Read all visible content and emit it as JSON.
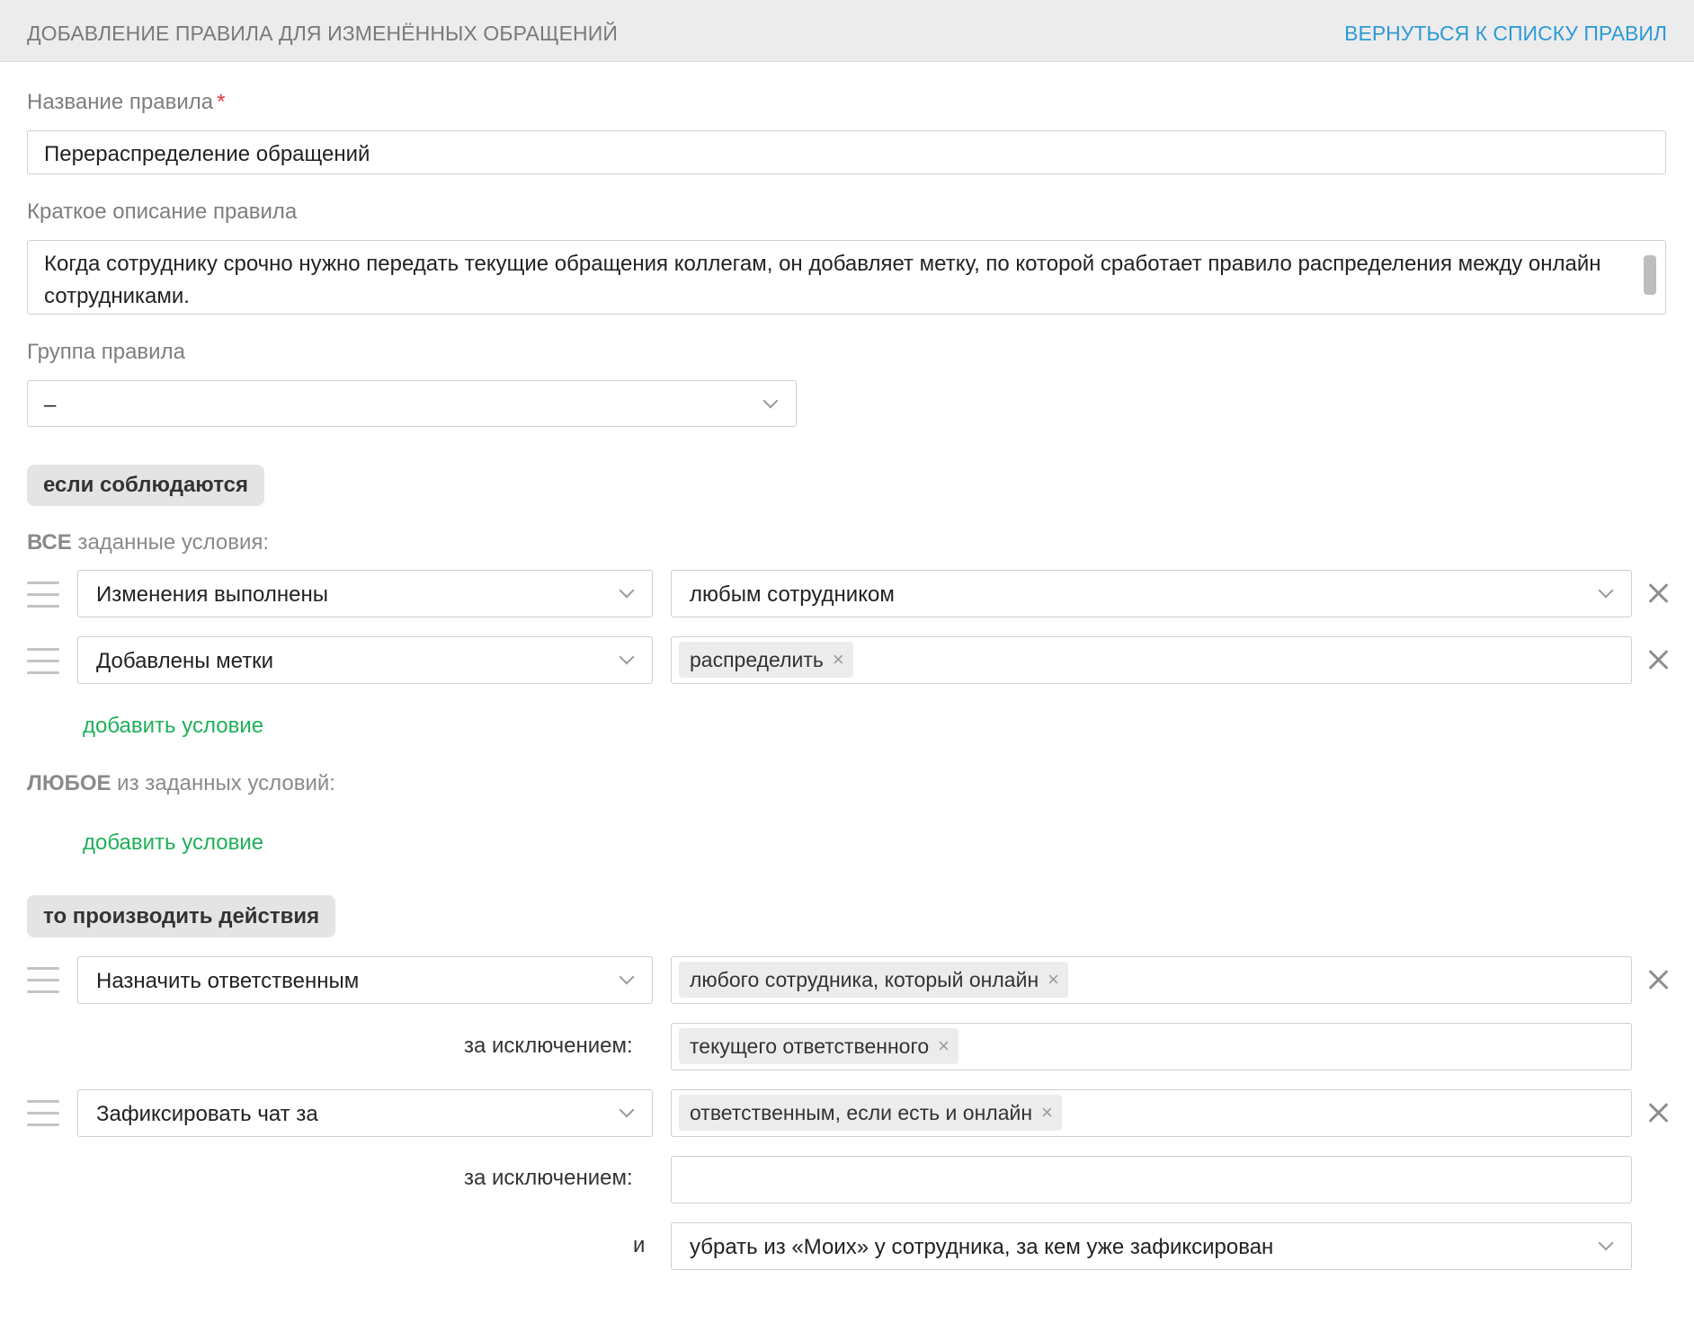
{
  "header": {
    "title": "ДОБАВЛЕНИЕ ПРАВИЛА ДЛЯ ИЗМЕНЁННЫХ ОБРАЩЕНИЙ",
    "back_link": "ВЕРНУТЬСЯ К СПИСКУ ПРАВИЛ"
  },
  "form": {
    "name_label": "Название правила",
    "required_mark": "*",
    "name_value": "Перераспределение обращений",
    "description_label": "Краткое описание правила",
    "description_value": "Когда сотруднику срочно нужно передать текущие обращения коллегам, он добавляет метку, по которой сработает правило распределения между онлайн сотрудниками.",
    "group_label": "Группа правила",
    "group_value": "–"
  },
  "conditions": {
    "pill": "если соблюдаются",
    "all_bold": "ВСЕ",
    "all_rest": " заданные условия:",
    "rows": [
      {
        "field": "Изменения выполнены",
        "value": "любым сотрудником"
      },
      {
        "field": "Добавлены метки",
        "tag": "распределить"
      }
    ],
    "add_label": "добавить условие",
    "any_bold": "ЛЮБОЕ",
    "any_rest": " из заданных условий:",
    "add_label_any": "добавить условие"
  },
  "actions": {
    "pill": "то производить действия",
    "rows": [
      {
        "field": "Назначить ответственным",
        "tag": "любого сотрудника, который онлайн",
        "except_label": "за исключением:",
        "except_tag": "текущего ответственного"
      },
      {
        "field": "Зафиксировать чат за",
        "tag": "ответственным, если есть и онлайн",
        "except_label": "за исключением:",
        "and_label": "и",
        "and_value": "убрать из «Моих» у сотрудника, за кем уже зафиксирован"
      }
    ]
  },
  "icons": {
    "remove": "close-icon",
    "drag": "drag-handle-icon",
    "dropdown": "chevron-down-icon",
    "tag_remove": "×"
  },
  "colors": {
    "header_bg": "#ececec",
    "link": "#2e9ad6",
    "add_link": "#1fb05a",
    "required": "#e53935"
  }
}
